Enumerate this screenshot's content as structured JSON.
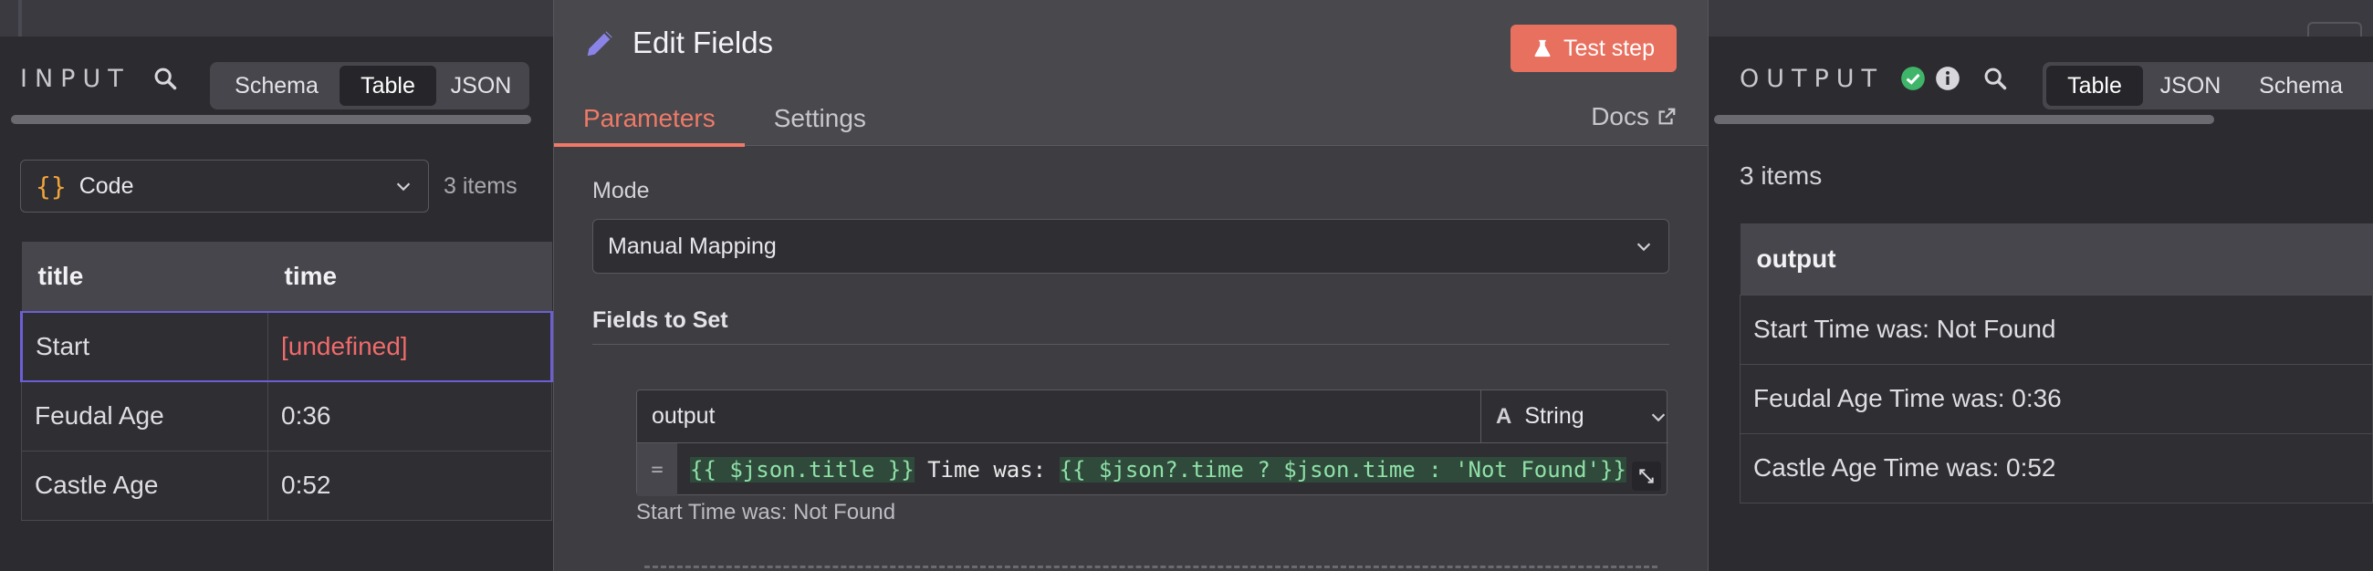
{
  "input": {
    "title": "INPUT",
    "view_tabs": [
      "Schema",
      "Table",
      "JSON"
    ],
    "active_tab": "Table",
    "node_select": {
      "icon": "{}",
      "label": "Code"
    },
    "items_count": "3 items",
    "table": {
      "headers": [
        "title",
        "time"
      ],
      "rows": [
        [
          "Start",
          "[undefined]"
        ],
        [
          "Feudal Age",
          "0:36"
        ],
        [
          "Castle Age",
          "0:52"
        ]
      ]
    }
  },
  "modal": {
    "title": "Edit Fields",
    "test_button": "Test step",
    "tabs": [
      "Parameters",
      "Settings"
    ],
    "active_tab": "Parameters",
    "docs_link": "Docs",
    "mode_label": "Mode",
    "mode_value": "Manual Mapping",
    "fields_label": "Fields to Set",
    "field": {
      "name": "output",
      "type": "String",
      "type_icon": "A",
      "eq": "=",
      "expr_part1": "{{ $json.title }}",
      "expr_mid": " Time was: ",
      "expr_part2": "{{ $json?.time ? $json.time : 'Not Found'}}",
      "result": "Start Time was: Not Found"
    },
    "accent_color": "#ef7a67"
  },
  "output": {
    "title": "OUTPUT",
    "view_tabs": [
      "Table",
      "JSON",
      "Schema"
    ],
    "active_tab": "Table",
    "items_count": "3 items",
    "table": {
      "headers": [
        "output"
      ],
      "rows": [
        [
          "Start Time was: Not Found"
        ],
        [
          "Feudal Age Time was: 0:36"
        ],
        [
          "Castle Age Time was: 0:52"
        ]
      ]
    }
  }
}
